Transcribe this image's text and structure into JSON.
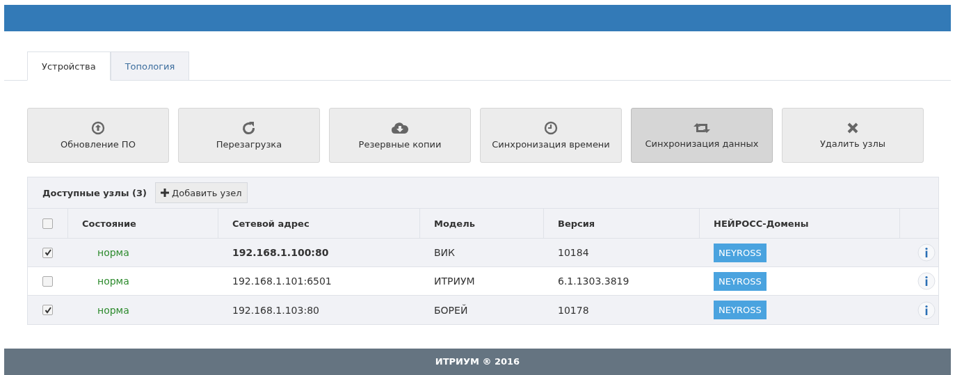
{
  "tabs": [
    {
      "label": "Устройства",
      "selected": true
    },
    {
      "label": "Топология",
      "selected": false
    }
  ],
  "toolbar": [
    {
      "kind": "upload",
      "label": "Обновление ПО",
      "hovered": false
    },
    {
      "kind": "reload",
      "label": "Перезагрузка",
      "hovered": false
    },
    {
      "kind": "cloud",
      "label": "Резервные копии",
      "hovered": false
    },
    {
      "kind": "clock",
      "label": "Синхронизация времени",
      "hovered": false
    },
    {
      "kind": "sync",
      "label": "Синхронизация данных",
      "hovered": true
    },
    {
      "kind": "close",
      "label": "Удалить узлы",
      "hovered": false
    }
  ],
  "panel": {
    "title": "Доступные узлы (3)",
    "add_button": "Добавить узел"
  },
  "table": {
    "select_all_checked": false,
    "columns": [
      "Состояние",
      "Сетевой адрес",
      "Модель",
      "Версия",
      "НЕЙРОСС-Домены"
    ],
    "rows": [
      {
        "checked": true,
        "status": "норма",
        "address": "192.168.1.100:80",
        "address_bold": true,
        "model": "ВИК",
        "version": "10184",
        "domain": "NEYROSS"
      },
      {
        "checked": false,
        "status": "норма",
        "address": "192.168.1.101:6501",
        "address_bold": false,
        "model": "ИТРИУМ",
        "version": "6.1.1303.3819",
        "domain": "NEYROSS"
      },
      {
        "checked": true,
        "status": "норма",
        "address": "192.168.1.103:80",
        "address_bold": false,
        "model": "БОРЕЙ",
        "version": "10178",
        "domain": "NEYROSS"
      }
    ]
  },
  "footer": "ИТРИУМ ® 2016"
}
